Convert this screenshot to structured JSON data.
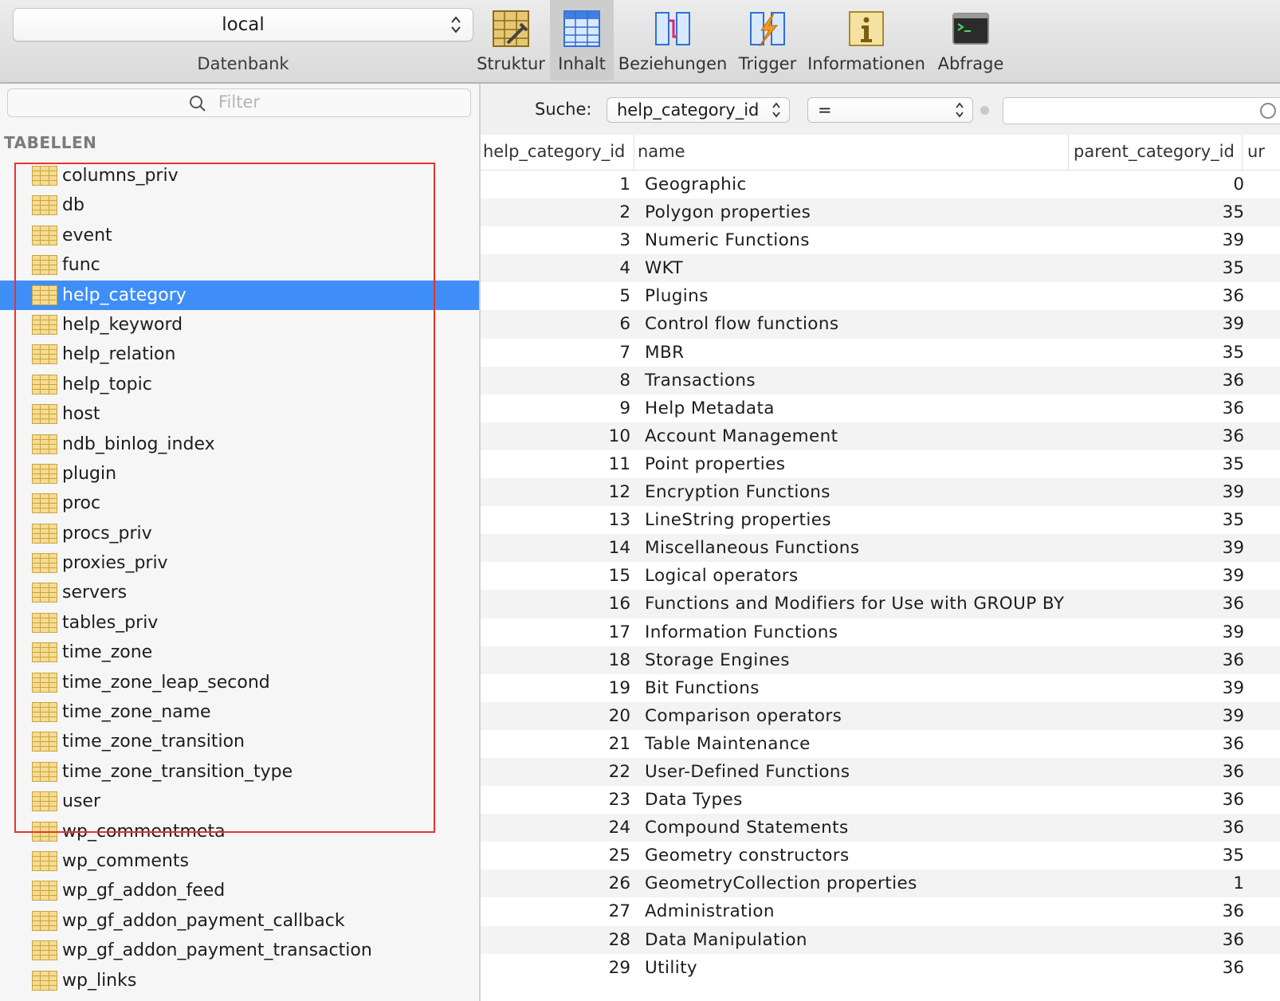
{
  "toolbar": {
    "database_select": "local",
    "database_label": "Datenbank",
    "tools": [
      {
        "label": "Struktur",
        "icon": "structure-icon"
      },
      {
        "label": "Inhalt",
        "icon": "content-icon"
      },
      {
        "label": "Beziehungen",
        "icon": "relations-icon"
      },
      {
        "label": "Trigger",
        "icon": "trigger-icon"
      },
      {
        "label": "Informationen",
        "icon": "info-icon"
      },
      {
        "label": "Abfrage",
        "icon": "terminal-icon"
      }
    ],
    "active_tool": "Inhalt"
  },
  "sidebar": {
    "filter_placeholder": "Filter",
    "section_title": "TABELLEN",
    "selected_table": "help_category",
    "tables": [
      "columns_priv",
      "db",
      "event",
      "func",
      "help_category",
      "help_keyword",
      "help_relation",
      "help_topic",
      "host",
      "ndb_binlog_index",
      "plugin",
      "proc",
      "procs_priv",
      "proxies_priv",
      "servers",
      "tables_priv",
      "time_zone",
      "time_zone_leap_second",
      "time_zone_name",
      "time_zone_transition",
      "time_zone_transition_type",
      "user",
      "wp_commentmeta",
      "wp_comments",
      "wp_gf_addon_feed",
      "wp_gf_addon_payment_callback",
      "wp_gf_addon_payment_transaction",
      "wp_links"
    ]
  },
  "search": {
    "label": "Suche:",
    "field": "help_category_id",
    "operator": "=",
    "value": ""
  },
  "table": {
    "columns": [
      "help_category_id",
      "name",
      "parent_category_id",
      "ur"
    ],
    "rows": [
      {
        "id": "1",
        "name": "Geographic",
        "parent": "0"
      },
      {
        "id": "2",
        "name": "Polygon properties",
        "parent": "35"
      },
      {
        "id": "3",
        "name": "Numeric Functions",
        "parent": "39"
      },
      {
        "id": "4",
        "name": "WKT",
        "parent": "35"
      },
      {
        "id": "5",
        "name": "Plugins",
        "parent": "36"
      },
      {
        "id": "6",
        "name": "Control flow functions",
        "parent": "39"
      },
      {
        "id": "7",
        "name": "MBR",
        "parent": "35"
      },
      {
        "id": "8",
        "name": "Transactions",
        "parent": "36"
      },
      {
        "id": "9",
        "name": "Help Metadata",
        "parent": "36"
      },
      {
        "id": "10",
        "name": "Account Management",
        "parent": "36"
      },
      {
        "id": "11",
        "name": "Point properties",
        "parent": "35"
      },
      {
        "id": "12",
        "name": "Encryption Functions",
        "parent": "39"
      },
      {
        "id": "13",
        "name": "LineString properties",
        "parent": "35"
      },
      {
        "id": "14",
        "name": "Miscellaneous Functions",
        "parent": "39"
      },
      {
        "id": "15",
        "name": "Logical operators",
        "parent": "39"
      },
      {
        "id": "16",
        "name": "Functions and Modifiers for Use with GROUP BY",
        "parent": "36"
      },
      {
        "id": "17",
        "name": "Information Functions",
        "parent": "39"
      },
      {
        "id": "18",
        "name": "Storage Engines",
        "parent": "36"
      },
      {
        "id": "19",
        "name": "Bit Functions",
        "parent": "39"
      },
      {
        "id": "20",
        "name": "Comparison operators",
        "parent": "39"
      },
      {
        "id": "21",
        "name": "Table Maintenance",
        "parent": "36"
      },
      {
        "id": "22",
        "name": "User-Defined Functions",
        "parent": "36"
      },
      {
        "id": "23",
        "name": "Data Types",
        "parent": "36"
      },
      {
        "id": "24",
        "name": "Compound Statements",
        "parent": "36"
      },
      {
        "id": "25",
        "name": "Geometry constructors",
        "parent": "35"
      },
      {
        "id": "26",
        "name": "GeometryCollection properties",
        "parent": "1"
      },
      {
        "id": "27",
        "name": "Administration",
        "parent": "36"
      },
      {
        "id": "28",
        "name": "Data Manipulation",
        "parent": "36"
      },
      {
        "id": "29",
        "name": "Utility",
        "parent": "36"
      }
    ]
  },
  "colors": {
    "selection": "#3f8ef7",
    "highlight_box": "#e8342a",
    "table_icon": "#f0d68a"
  }
}
